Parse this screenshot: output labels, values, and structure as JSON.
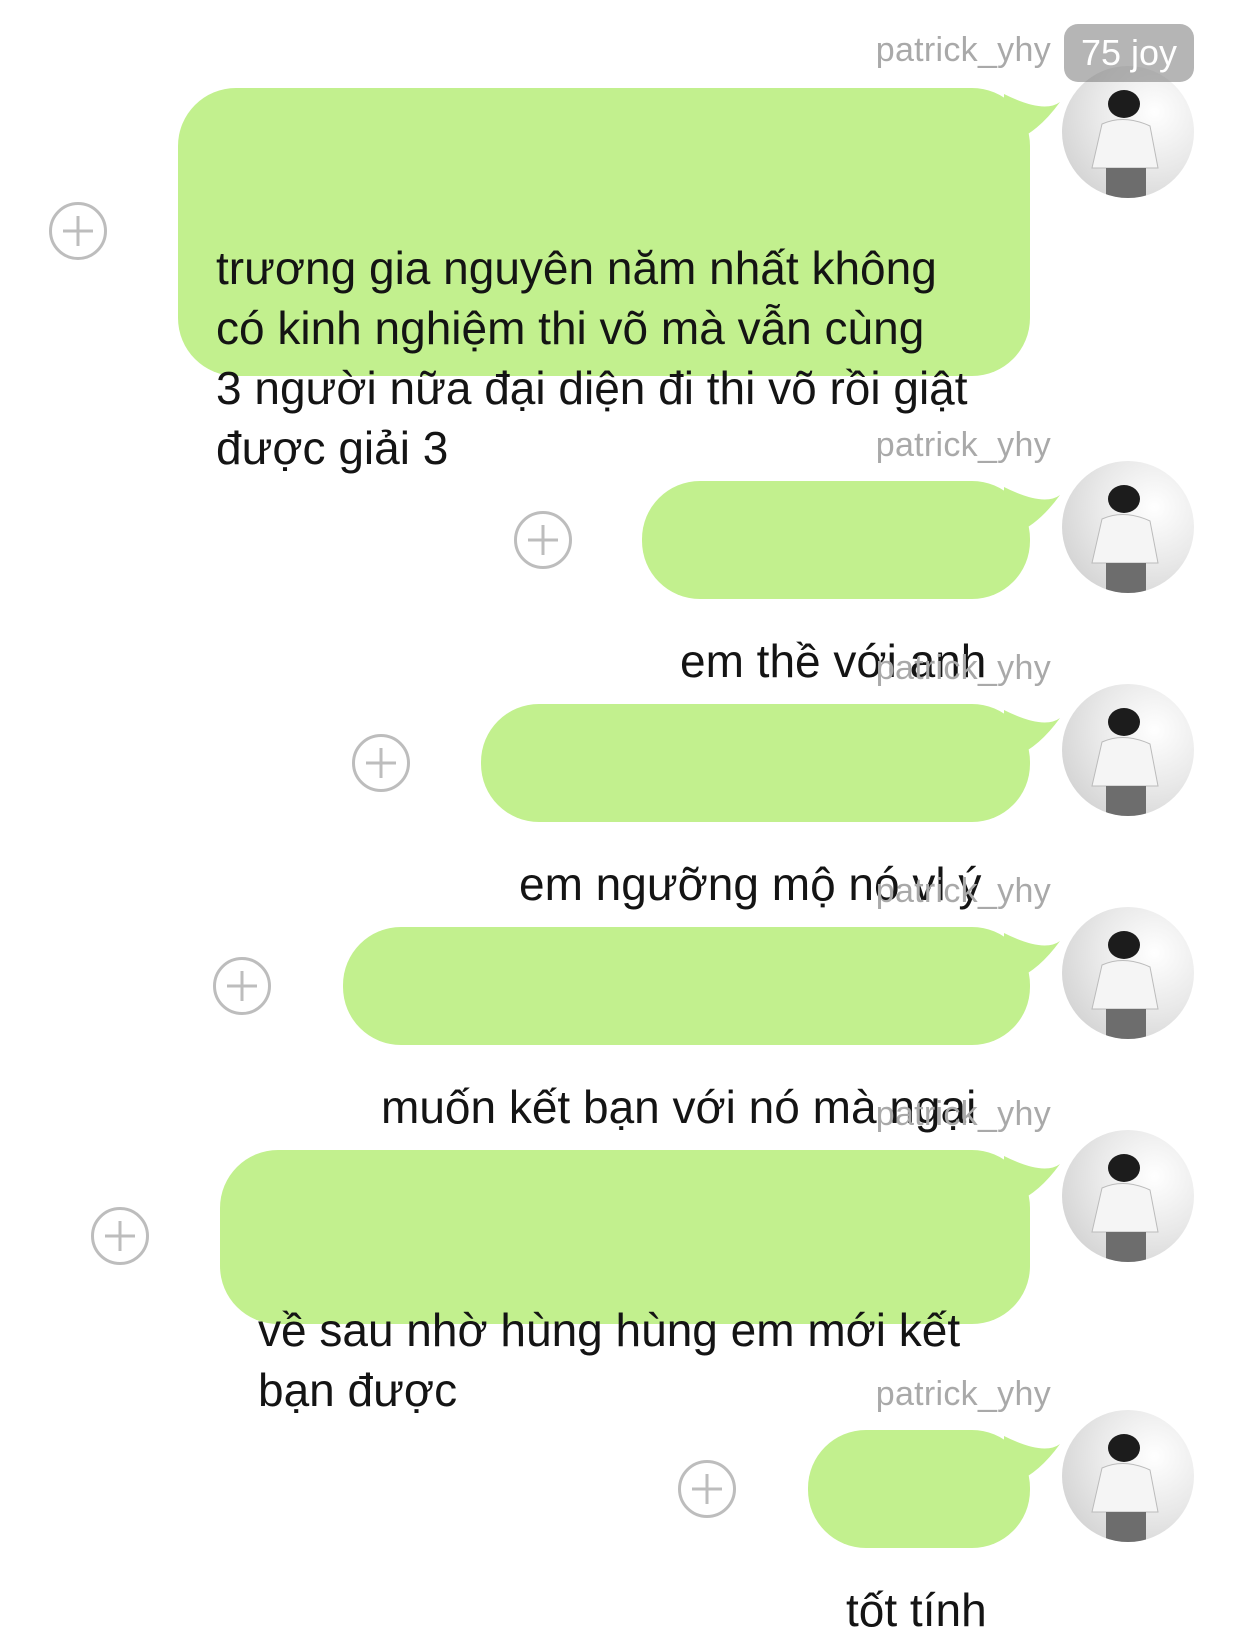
{
  "top_badge": "75 joy",
  "messages": [
    {
      "username": "patrick_yhy",
      "text": "trương gia nguyên năm nhất không\ncó kinh nghiệm thi võ mà vẫn cùng\n3 người nữa đại diện đi thi võ rồi giật\nđược giải 3"
    },
    {
      "username": "patrick_yhy",
      "text": "em thề với anh"
    },
    {
      "username": "patrick_yhy",
      "text": "em ngưỡng mộ nó vl ý"
    },
    {
      "username": "patrick_yhy",
      "text": "muốn kết bạn với nó mà ngại"
    },
    {
      "username": "patrick_yhy",
      "text": "về sau nhờ hùng hùng em mới kết\nbạn được"
    },
    {
      "username": "patrick_yhy",
      "text": "tốt tính"
    }
  ],
  "colors": {
    "bubble": "#c2f08e",
    "username": "#a9a9a9",
    "plus_icon": "#bdbdbd"
  }
}
